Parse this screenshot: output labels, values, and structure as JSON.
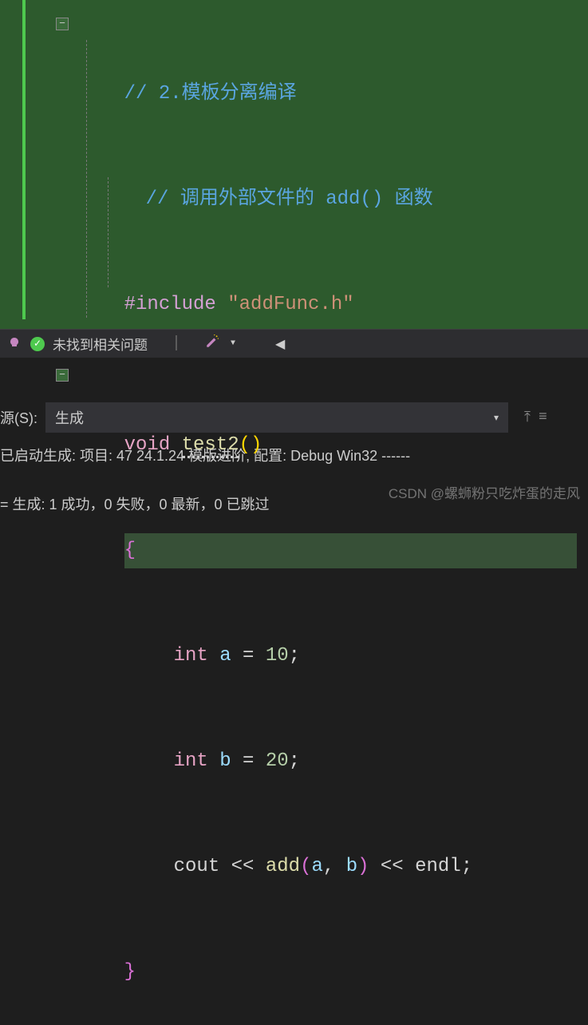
{
  "code": {
    "line1": "// 2.模板分离编译",
    "line2": "// 调用外部文件的 add() 函数",
    "line3_pre": "#include",
    "line3_str": "\"addFunc.h\"",
    "line4_kw": "void",
    "line4_fn": "test2",
    "line5_brace": "{",
    "line6_type": "int",
    "line6_var": "a",
    "line6_eq": "=",
    "line6_val": "10",
    "line7_type": "int",
    "line7_var": "b",
    "line7_eq": "=",
    "line7_val": "20",
    "line8_cout": "cout",
    "line8_op": "<<",
    "line8_fn": "add",
    "line8_a": "a",
    "line8_b": "b",
    "line8_endl": "endl",
    "line9_brace": "}"
  },
  "status": {
    "no_issues": "未找到相关问题"
  },
  "output": {
    "source_label": "源(S):",
    "dropdown_value": "生成",
    "line1": "已启动生成: 项目: 47 24.1.24 模版进阶, 配置: Debug Win32 ------",
    "line2": "= 生成: 1 成功，0 失败，0 最新，0 已跳过"
  },
  "watermark": "CSDN @螺蛳粉只吃炸蛋的走风"
}
